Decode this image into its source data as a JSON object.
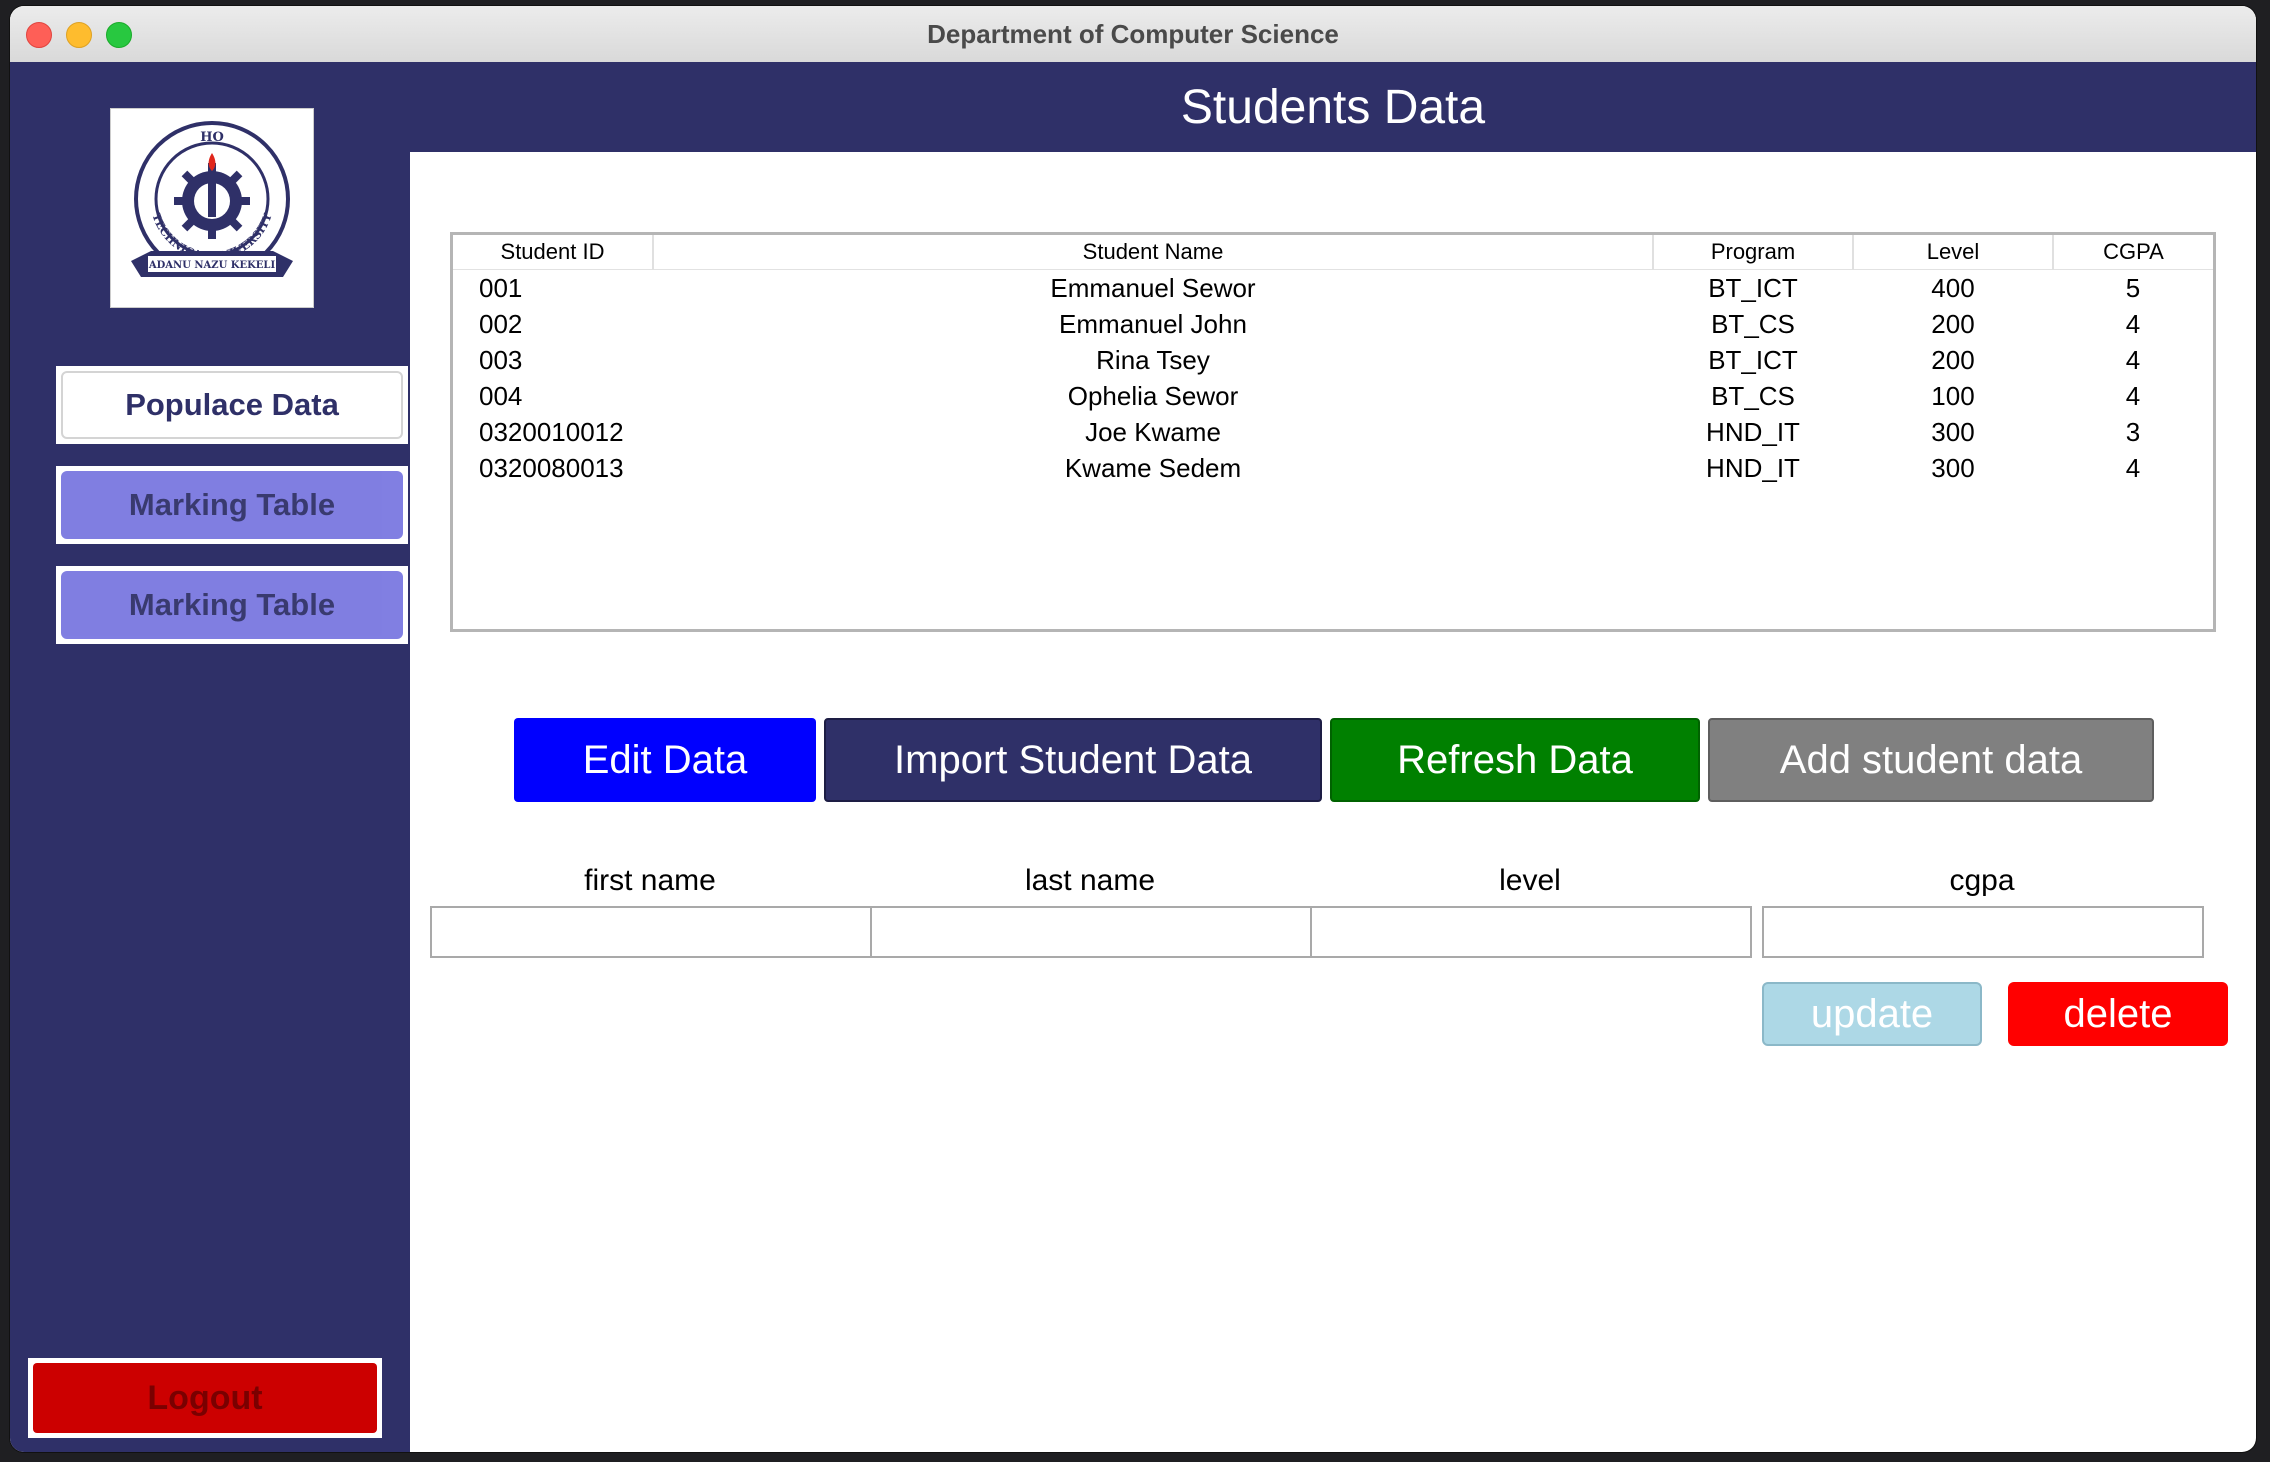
{
  "window": {
    "title": "Department  of Computer Science"
  },
  "logo": {
    "top_text": "HO",
    "ring_text": "TECHNICAL UNIVERSITY",
    "banner_text": "ADANU NAZU KEKELI"
  },
  "sidebar": {
    "populace_label": "Populace Data",
    "marking1_label": "Marking Table",
    "marking2_label": "Marking Table",
    "logout_label": "Logout"
  },
  "header": {
    "title": "Students Data"
  },
  "table": {
    "columns": [
      "Student ID",
      "Student Name",
      "Program",
      "Level",
      "CGPA"
    ],
    "rows": [
      [
        "001",
        "Emmanuel Sewor",
        "BT_ICT",
        "400",
        "5"
      ],
      [
        "002",
        "Emmanuel John",
        "BT_CS",
        "200",
        "4"
      ],
      [
        "003",
        "Rina Tsey",
        "BT_ICT",
        "200",
        "4"
      ],
      [
        "004",
        "Ophelia Sewor",
        "BT_CS",
        "100",
        "4"
      ],
      [
        "0320010012",
        "Joe Kwame",
        "HND_IT",
        "300",
        "3"
      ],
      [
        "0320080013",
        "Kwame Sedem",
        "HND_IT",
        "300",
        "4"
      ]
    ]
  },
  "actions": {
    "edit_label": "Edit Data",
    "import_label": "Import Student Data",
    "refresh_label": "Refresh Data",
    "add_label": "Add student data"
  },
  "form": {
    "first_name_label": "first name",
    "last_name_label": "last name",
    "level_label": "level",
    "cgpa_label": "cgpa",
    "first_name_value": "",
    "last_name_value": "",
    "level_value": "",
    "cgpa_value": "",
    "update_label": "update",
    "delete_label": "delete"
  },
  "colors": {
    "navy": "#2f3068",
    "edit_blue": "#0000ff",
    "refresh_green": "#008000",
    "add_gray": "#808080",
    "update_lightblue": "#add8e6",
    "delete_red": "#ff0000",
    "logout_red": "#cc0000",
    "marking_purple": "#7a78e0"
  }
}
